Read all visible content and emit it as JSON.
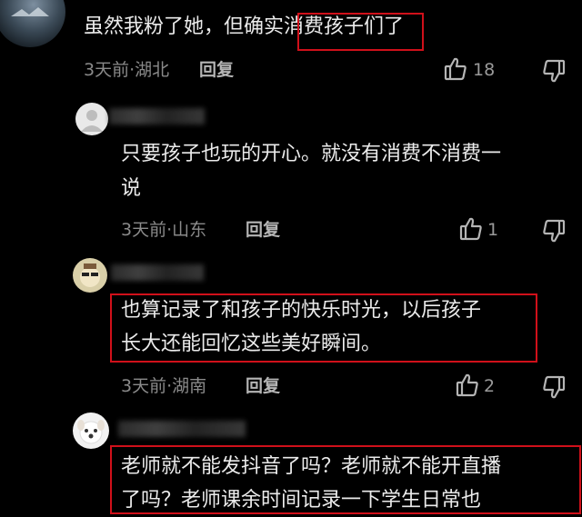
{
  "comments": [
    {
      "text": "虽然我粉了她，但确实消费孩子们了",
      "highlight": "消费孩子们了",
      "meta": "3天前·湖北",
      "reply_label": "回复",
      "likes": "18"
    },
    {
      "text_line1": "只要孩子也玩的开心。就没有消费不消费一",
      "text_line2": "说",
      "meta": "3天前·山东",
      "reply_label": "回复",
      "likes": "1"
    },
    {
      "text_line1": "也算记录了和孩子的快乐时光，以后孩子",
      "text_line2": "长大还能回忆这些美好瞬间。",
      "meta": "3天前·湖南",
      "reply_label": "回复",
      "likes": "2"
    },
    {
      "text_line1": "老师就不能发抖音了吗？老师就不能开直播",
      "text_line2": "了吗？老师课余时间记录一下学生日常也"
    }
  ],
  "colors": {
    "background": "#000000",
    "highlight_border": "#d0101a"
  }
}
